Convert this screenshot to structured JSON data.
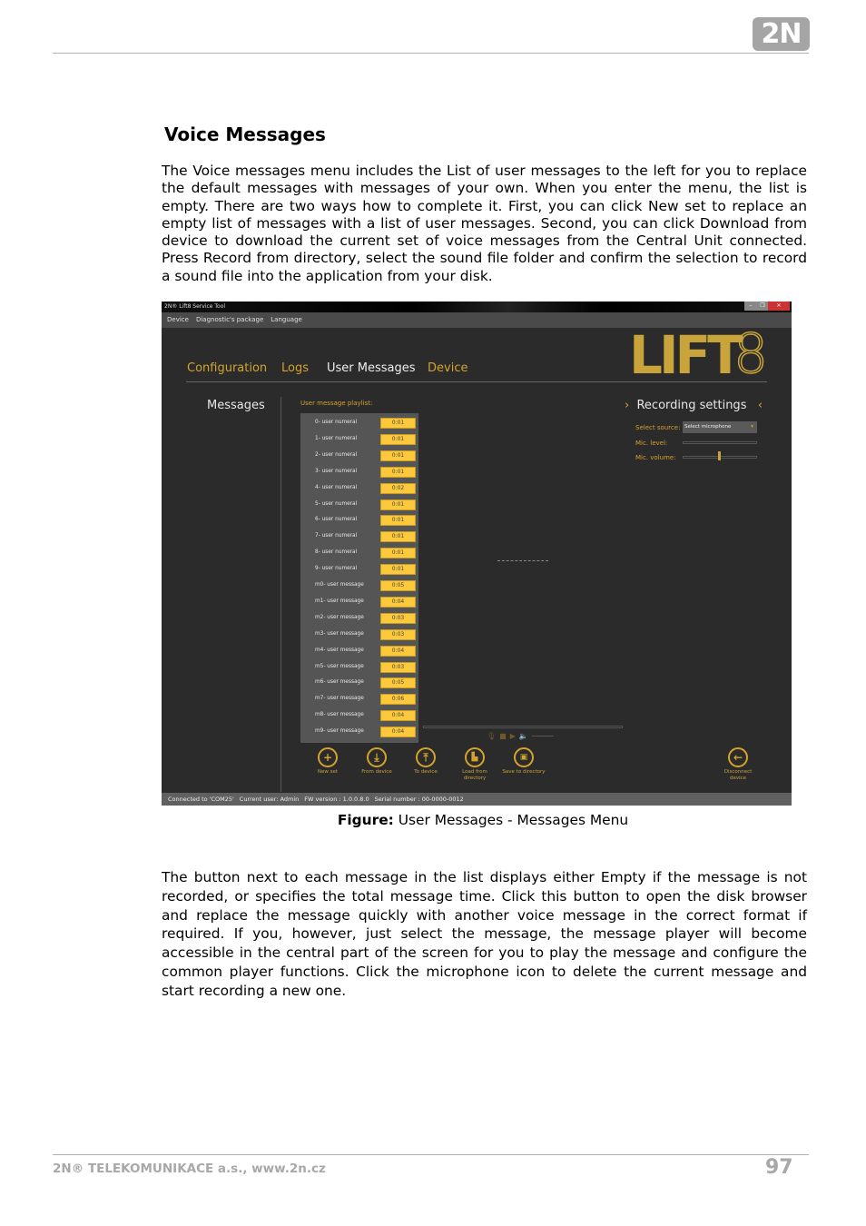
{
  "header": {
    "logo": "2N"
  },
  "title": "Voice Messages",
  "intro": "The Voice messages menu includes the List of user messages to the left for you to replace the default messages with messages of your own. When you enter the menu, the list is empty. There are two ways how to complete it. First, you can click New set to replace an empty list of messages with a list of user messages. Second, you can click Download from device to download the current set of voice messages from the Central Unit connected. Press Record from directory, select the sound file folder and confirm the selection to record a sound file into the application from your disk.",
  "screenshot": {
    "window_title": "2N® Lift8 Service Tool",
    "menu": [
      "Device",
      "Diagnostic's package",
      "Language"
    ],
    "tabs": [
      "Configuration",
      "Logs",
      "User Messages",
      "Device"
    ],
    "active_tab": "User Messages",
    "logo": "LIFT8",
    "section": "Messages",
    "playlist_title": "User message playlist:",
    "playlist": [
      {
        "name": "0- user numeral",
        "duration": "0:01"
      },
      {
        "name": "1- user numeral",
        "duration": "0:01"
      },
      {
        "name": "2- user numeral",
        "duration": "0:01"
      },
      {
        "name": "3- user numeral",
        "duration": "0:01"
      },
      {
        "name": "4- user numeral",
        "duration": "0:02"
      },
      {
        "name": "5- user numeral",
        "duration": "0:01"
      },
      {
        "name": "6- user numeral",
        "duration": "0:01"
      },
      {
        "name": "7- user numeral",
        "duration": "0:01"
      },
      {
        "name": "8- user numeral",
        "duration": "0:01"
      },
      {
        "name": "9- user numeral",
        "duration": "0:01"
      },
      {
        "name": "m0- user message",
        "duration": "0:05"
      },
      {
        "name": "m1- user message",
        "duration": "0:04"
      },
      {
        "name": "m2- user message",
        "duration": "0:03"
      },
      {
        "name": "m3- user message",
        "duration": "0:03"
      },
      {
        "name": "m4- user message",
        "duration": "0:04"
      },
      {
        "name": "m5- user message",
        "duration": "0:03"
      },
      {
        "name": "m6- user message",
        "duration": "0:05"
      },
      {
        "name": "m7- user message",
        "duration": "0:06"
      },
      {
        "name": "m8- user message",
        "duration": "0:04"
      },
      {
        "name": "m9- user message",
        "duration": "0:04"
      }
    ],
    "recording": {
      "title": "Recording settings",
      "source_label": "Select source:",
      "source_value": "Select microphone",
      "mic_level_label": "Mic. level:",
      "mic_volume_label": "Mic. volume:",
      "mic_volume": 0.5
    },
    "buttons": {
      "new_set": "New set",
      "from_device": "From device",
      "to_device": "To device",
      "load": "Load from directory",
      "save": "Save to directory",
      "disconnect": "Disconnect device"
    },
    "status": [
      "Connected to 'COM25'",
      "Current user: Admin",
      "FW version : 1.0.0.8.0",
      "Serial number : 00-0000-0012"
    ],
    "accent": "#d4a32e",
    "duration_bg": "#fcc93c"
  },
  "caption": {
    "bold": "Figure:",
    "text": " User Messages - Messages Menu"
  },
  "body": "The button next to each message in the list displays either Empty if the message is not recorded, or specifies the total message time. Click this button to open the disk browser and replace the message quickly with another voice message in the correct format if required. If you, however, just select the message, the message player will become accessible in the central part of the screen for you to play the message and configure the common player functions. Click the microphone icon to delete the current message and start recording a new one.",
  "footer": {
    "company": "2N® TELEKOMUNIKACE a.s., www.2n.cz",
    "page": "97"
  }
}
